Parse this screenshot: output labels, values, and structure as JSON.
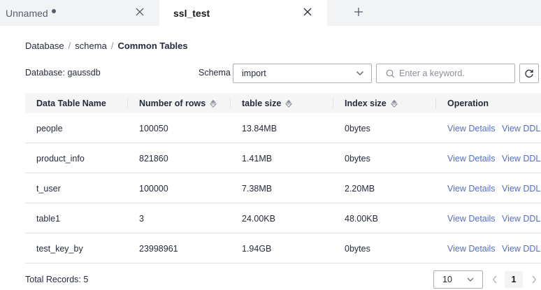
{
  "tabs": [
    {
      "label": "Unnamed",
      "modified": true
    },
    {
      "label": "ssl_test"
    }
  ],
  "breadcrumb": {
    "items": [
      "Database",
      "schema",
      "Common Tables"
    ],
    "separator": "/"
  },
  "filters": {
    "database_label": "Database: gaussdb",
    "schema_label": "Schema",
    "schema_value": "import",
    "search_placeholder": "Enter a keyword."
  },
  "table": {
    "columns": [
      "Data Table Name",
      "Number of rows",
      "table size",
      "Index size",
      "Operation"
    ],
    "rows": [
      {
        "name": "people",
        "rows": "100050",
        "table_size": "13.84MB",
        "index_size": "0bytes",
        "op1": "View Details",
        "op2": "View DDL"
      },
      {
        "name": "product_info",
        "rows": "821860",
        "table_size": "1.41MB",
        "index_size": "0bytes",
        "op1": "View Details",
        "op2": "View DDL"
      },
      {
        "name": "t_user",
        "rows": "100000",
        "table_size": "7.38MB",
        "index_size": "2.20MB",
        "op1": "View Details",
        "op2": "View DDL"
      },
      {
        "name": "table1",
        "rows": "3",
        "table_size": "24.00KB",
        "index_size": "48.00KB",
        "op1": "View Details",
        "op2": "View DDL"
      },
      {
        "name": "test_key_by",
        "rows": "23998961",
        "table_size": "1.94GB",
        "index_size": "0bytes",
        "op1": "View Details",
        "op2": "View DDL"
      }
    ]
  },
  "footer": {
    "total_records": "Total Records: 5",
    "page_size": "10",
    "current_page": "1"
  },
  "colors": {
    "link": "#526ecc",
    "border": "#dfe1e6",
    "header_bg": "#f5f5f6",
    "tabbar_bg": "#f2f3f5"
  }
}
